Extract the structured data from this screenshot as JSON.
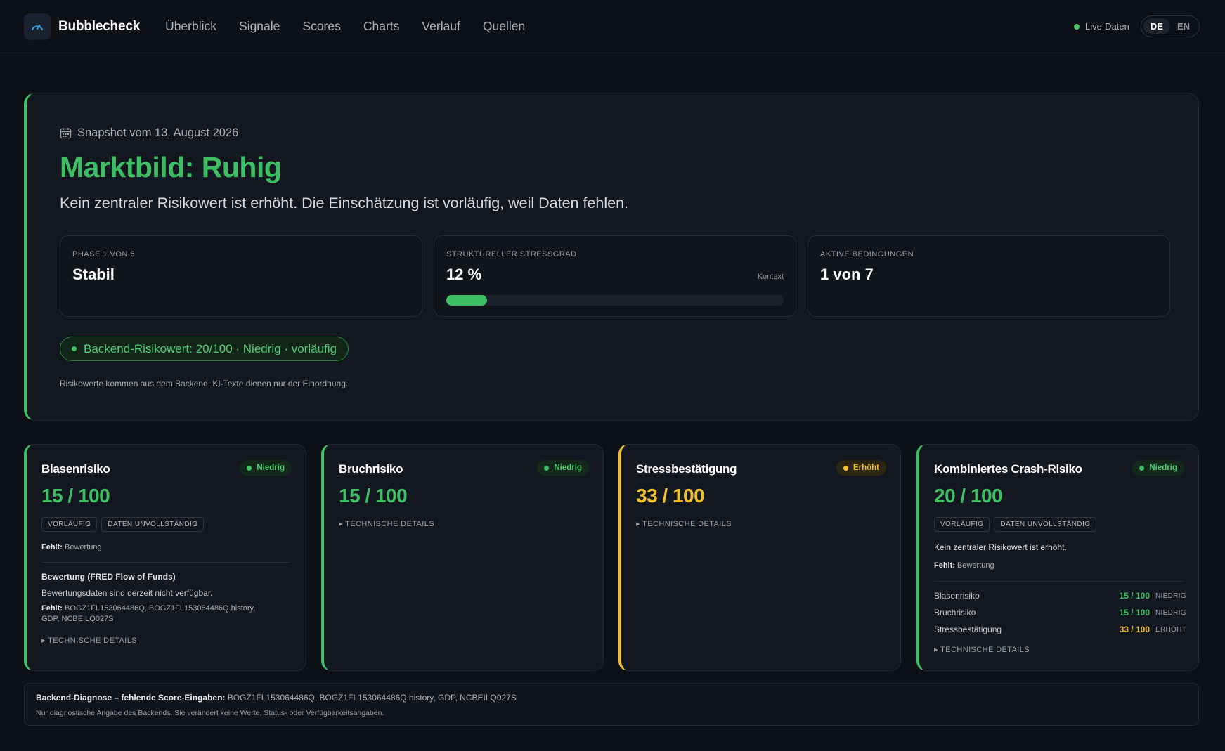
{
  "header": {
    "brand": "Bubblecheck",
    "nav": [
      "Überblick",
      "Signale",
      "Scores",
      "Charts",
      "Verlauf",
      "Quellen"
    ],
    "live_label": "Live-Daten",
    "languages": [
      "DE",
      "EN"
    ],
    "active_language": "DE"
  },
  "hero": {
    "snapshot": "Snapshot vom 13. August 2026",
    "title": "Marktbild: Ruhig",
    "subtitle": "Kein zentraler Risikowert ist erhöht. Die Einschätzung ist vorläufig, weil Daten fehlen.",
    "metrics": {
      "phase": {
        "label": "PHASE 1 VON 6",
        "value": "Stabil"
      },
      "stress": {
        "label": "STRUKTURELLER STRESSGRAD",
        "value": "12 %",
        "context": "Kontext",
        "fraction": 0.12
      },
      "conditions": {
        "label": "AKTIVE BEDINGUNGEN",
        "value": "1 von 7"
      }
    },
    "backend_pill": "Backend-Risikowert: 20/100 · Niedrig · vorläufig",
    "note": "Risikowerte kommen aus dem Backend. KI-Texte dienen nur der Einordnung."
  },
  "cards": {
    "bubble": {
      "title": "Blasenrisiko",
      "badge": "Niedrig",
      "score": "15 / 100",
      "tags": [
        "VORLÄUFIG",
        "DATEN UNVOLLSTÄNDIG"
      ],
      "missing_label": "Fehlt:",
      "missing_value": "Bewertung",
      "section_title": "Bewertung (FRED Flow of Funds)",
      "section_text": "Bewertungsdaten sind derzeit nicht verfügbar.",
      "section_missing_label": "Fehlt:",
      "section_missing_value": "BOGZ1FL153064486Q, BOGZ1FL153064486Q.history, GDP, NCBEILQ027S",
      "details": "▸ TECHNISCHE DETAILS"
    },
    "break": {
      "title": "Bruchrisiko",
      "badge": "Niedrig",
      "score": "15 / 100",
      "details": "▸ TECHNISCHE DETAILS"
    },
    "stress": {
      "title": "Stressbestätigung",
      "badge": "Erhöht",
      "score": "33 / 100",
      "details": "▸ TECHNISCHE DETAILS"
    },
    "combined": {
      "title": "Kombiniertes Crash-Risiko",
      "badge": "Niedrig",
      "score": "20 / 100",
      "tags": [
        "VORLÄUFIG",
        "DATEN UNVOLLSTÄNDIG"
      ],
      "statement": "Kein zentraler Risikowert ist erhöht.",
      "missing_label": "Fehlt:",
      "missing_value": "Bewertung",
      "rows": [
        {
          "name": "Blasenrisiko",
          "value": "15 / 100",
          "status": "NIEDRIG"
        },
        {
          "name": "Bruchrisiko",
          "value": "15 / 100",
          "status": "NIEDRIG"
        },
        {
          "name": "Stressbestätigung",
          "value": "33 / 100",
          "status": "ERHÖHT"
        }
      ],
      "details": "▸ TECHNISCHE DETAILS"
    }
  },
  "diagnostics": {
    "label": "Backend-Diagnose – fehlende Score-Eingaben:",
    "value": "BOGZ1FL153064486Q, BOGZ1FL153064486Q.history, GDP, NCBEILQ027S",
    "note": "Nur diagnostische Angabe des Backends. Sie verändert keine Werte, Status- oder Verfügbarkeitsangaben."
  },
  "colors": {
    "ok": "#3fbf63",
    "warn": "#f0c02d",
    "background": "#0d1016"
  }
}
